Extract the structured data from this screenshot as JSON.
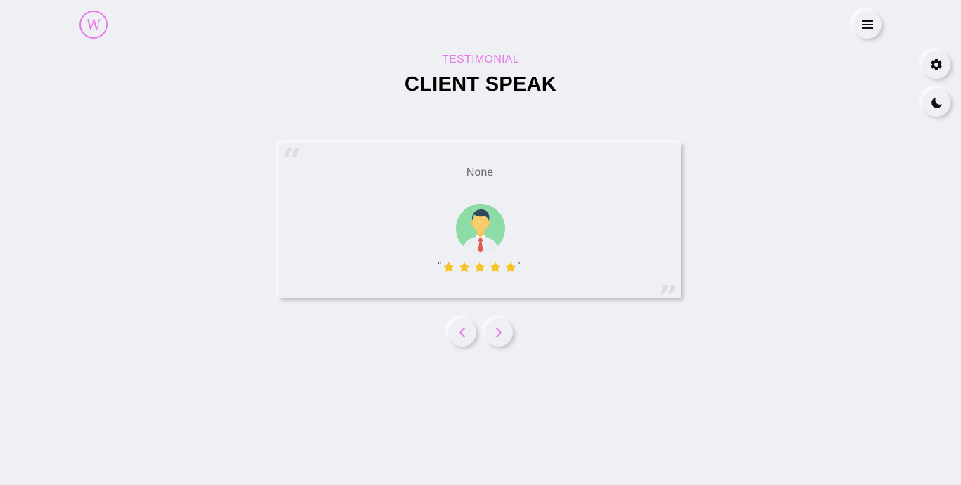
{
  "logo": {
    "letter": "W",
    "color": "#e879e8"
  },
  "header": {
    "subtitle": "TESTIMONIAL",
    "title": "CLIENT SPEAK"
  },
  "controls": {
    "menu_icon": "hamburger-menu-icon",
    "settings_icon": "gear-icon",
    "theme_icon": "moon-icon"
  },
  "testimonial": {
    "text": "None",
    "rating": 5,
    "rating_open": "\"",
    "rating_close": "\""
  },
  "navigation": {
    "prev_icon": "chevron-left-icon",
    "next_icon": "chevron-right-icon"
  },
  "colors": {
    "accent": "#e879e8",
    "background": "#eff0f4",
    "star": "#f6c324"
  }
}
